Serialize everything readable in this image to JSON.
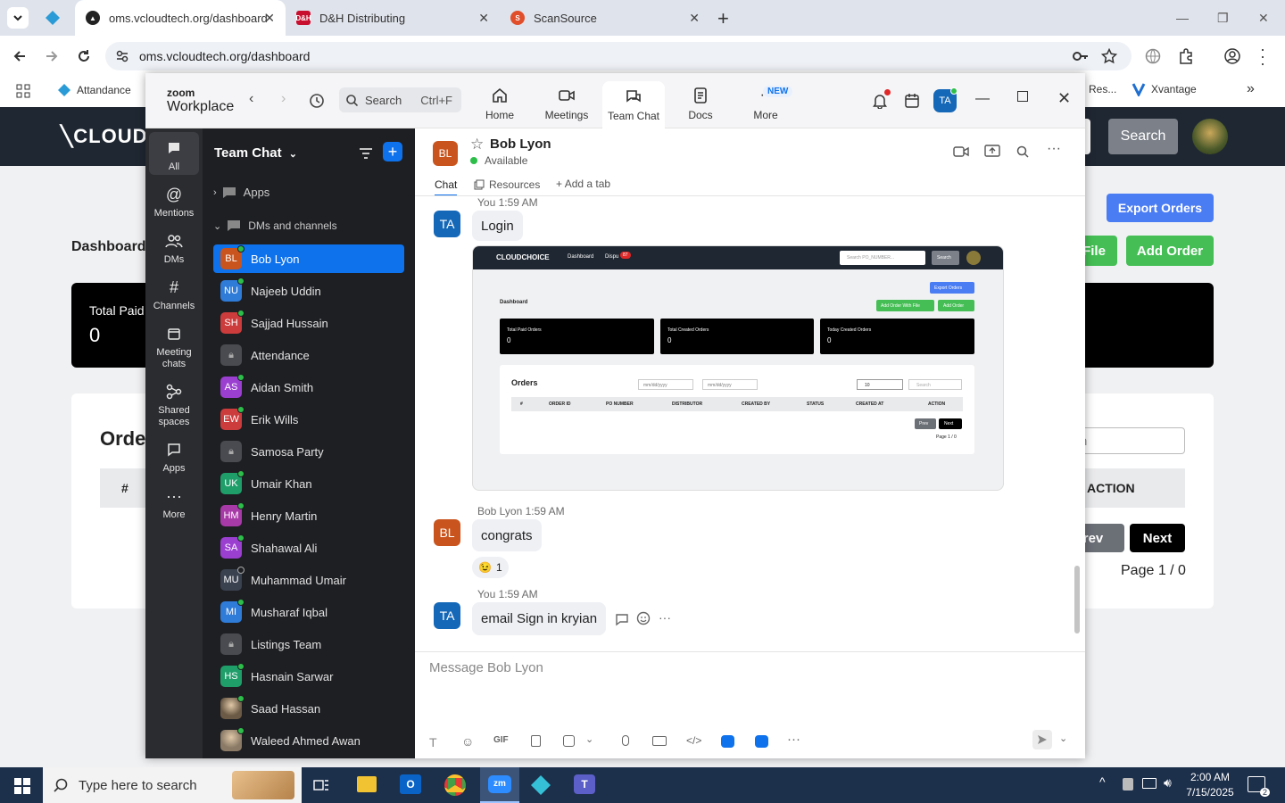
{
  "browser": {
    "tabs": [
      {
        "title": "oms.vcloudtech.org/dashboard",
        "active": true
      },
      {
        "title": "D&H Distributing",
        "active": false
      },
      {
        "title": "ScanSource",
        "active": false
      }
    ],
    "url": "oms.vcloudtech.org/dashboard",
    "bookmarks": {
      "attendance": "Attandance",
      "res": "Res...",
      "xvantage": "Xvantage"
    }
  },
  "site": {
    "brand": "CLOUDC",
    "search_button": "Search",
    "export_orders": "Export Orders",
    "add_order_file": "File",
    "add_order": "Add Order",
    "dashboard_title": "Dashboard",
    "total_paid_label": "Total Paid",
    "total_paid_value": "0",
    "orders_title": "Orde",
    "search_placeholder": "arch",
    "table_hash": "#",
    "table_action": "ACTION",
    "prev": "Prev",
    "next": "Next",
    "page": "Page 1 / 0"
  },
  "zoom": {
    "logo_top": "zoom",
    "logo_bottom": "Workplace",
    "search_placeholder": "Search",
    "search_shortcut": "Ctrl+F",
    "nav": [
      {
        "label": "Home",
        "icon": "home-icon"
      },
      {
        "label": "Meetings",
        "icon": "video-icon"
      },
      {
        "label": "Team Chat",
        "icon": "chat-icon"
      },
      {
        "label": "Docs",
        "icon": "docs-icon"
      },
      {
        "label": "More",
        "icon": "more-icon"
      }
    ],
    "new_badge": "NEW",
    "user_initials": "TA",
    "rail": [
      {
        "label": "All"
      },
      {
        "label": "Mentions"
      },
      {
        "label": "DMs"
      },
      {
        "label": "Channels"
      },
      {
        "label": "Meeting chats"
      },
      {
        "label": "Shared spaces"
      },
      {
        "label": "Apps"
      },
      {
        "label": "More"
      }
    ],
    "list_title": "Team Chat",
    "apps_section": "Apps",
    "dms_section": "DMs and channels",
    "contacts": [
      {
        "name": "Bob Lyon",
        "initials": "BL",
        "color": "#c9541d",
        "type": "user"
      },
      {
        "name": "Najeeb Uddin",
        "initials": "NU",
        "color": "#2f7bd8",
        "type": "user"
      },
      {
        "name": "Sajjad Hussain",
        "initials": "SH",
        "color": "#cc3c3c",
        "type": "user"
      },
      {
        "name": "Attendance",
        "initials": "",
        "color": "#4a4b50",
        "type": "channel"
      },
      {
        "name": "Aidan Smith",
        "initials": "AS",
        "color": "#9b3fd1",
        "type": "user"
      },
      {
        "name": "Erik Wills",
        "initials": "EW",
        "color": "#cc3c3c",
        "type": "user"
      },
      {
        "name": "Samosa Party",
        "initials": "",
        "color": "#4a4b50",
        "type": "channel"
      },
      {
        "name": "Umair Khan",
        "initials": "UK",
        "color": "#1f9e6a",
        "type": "user"
      },
      {
        "name": "Henry Martin",
        "initials": "HM",
        "color": "#a83aa8",
        "type": "user"
      },
      {
        "name": "Shahawal Ali",
        "initials": "SA",
        "color": "#9b3fd1",
        "type": "user"
      },
      {
        "name": "Muhammad Umair",
        "initials": "MU",
        "color": "#3a4250",
        "type": "user"
      },
      {
        "name": "Musharaf Iqbal",
        "initials": "MI",
        "color": "#2f7bd8",
        "type": "user"
      },
      {
        "name": "Listings Team",
        "initials": "",
        "color": "#4a4b50",
        "type": "channel"
      },
      {
        "name": "Hasnain Sarwar",
        "initials": "HS",
        "color": "#1f9e6a",
        "type": "user"
      },
      {
        "name": "Saad Hassan",
        "initials": "",
        "color": "#6b5a45",
        "type": "photo"
      },
      {
        "name": "Waleed Ahmed Awan",
        "initials": "",
        "color": "#8a7a66",
        "type": "photo"
      }
    ],
    "chat": {
      "name": "Bob Lyon",
      "initials": "BL",
      "status": "Available",
      "tabs": {
        "chat": "Chat",
        "resources": "Resources",
        "add_tab": "Add a tab"
      },
      "messages": [
        {
          "sender": "You",
          "time": "1:59 AM",
          "text": "Login",
          "initials": "TA"
        },
        {
          "sender": "Bob Lyon",
          "time": "1:59 AM",
          "text": "congrats",
          "initials": "BL",
          "reaction": "😉",
          "reaction_count": "1"
        },
        {
          "sender": "You",
          "time": "1:59 AM",
          "text": "email Sign in kryian",
          "initials": "TA"
        }
      ],
      "composer_placeholder": "Message Bob Lyon"
    },
    "screenshot": {
      "brand": "CLOUDCHOICE",
      "nav_dashboard": "Dashboard",
      "nav_dispu": "Dispu",
      "nav_badge": "87",
      "search_placeholder": "Search PO_NUMBER...",
      "search_btn": "Search",
      "export_orders": "Export Orders",
      "add_order_with_file": "Add Order With File",
      "add_order": "Add Order",
      "dashboard": "Dashboard",
      "cards": [
        {
          "label": "Total Paid Orders",
          "value": "0"
        },
        {
          "label": "Total Created Orders",
          "value": "0"
        },
        {
          "label": "Today Created Orders",
          "value": "0"
        }
      ],
      "orders_title": "Orders",
      "date1": "mm/dd/yyyy",
      "date2": "mm/dd/yyyy",
      "page_size": "10",
      "search": "Search",
      "columns": [
        "#",
        "ORDER ID",
        "PO NUMBER",
        "DISTRIBUTOR",
        "CREATED BY",
        "STATUS",
        "CREATED AT",
        "ACTION"
      ],
      "prev": "Prev",
      "next": "Next",
      "page": "Page 1 / 0"
    }
  },
  "taskbar": {
    "search_placeholder": "Type here to search",
    "time": "2:00 AM",
    "date": "7/15/2025",
    "notif_count": "2"
  },
  "colors": {
    "zoom_blue": "#0e72ed",
    "site_nav": "#1f2732",
    "online_green": "#2dbe4a"
  }
}
